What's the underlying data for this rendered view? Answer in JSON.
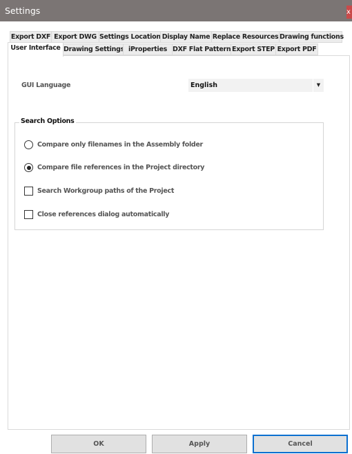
{
  "window": {
    "title": "Settings",
    "close_label": "x"
  },
  "tabs_row1": [
    {
      "label": "Export DXF"
    },
    {
      "label": "Export DWG"
    },
    {
      "label": "Settings Location"
    },
    {
      "label": "Display Name"
    },
    {
      "label": "Replace Resources"
    },
    {
      "label": "Drawing functions"
    }
  ],
  "tabs_row2": [
    {
      "label": "User Interface",
      "selected": true
    },
    {
      "label": "Drawing Settings"
    },
    {
      "label": "iProperties"
    },
    {
      "label": "DXF Flat Pattern"
    },
    {
      "label": "Export STEP"
    },
    {
      "label": "Export PDF"
    }
  ],
  "gui_language": {
    "label": "GUI Language",
    "value": "English"
  },
  "search_options": {
    "title": "Search Options",
    "options": [
      {
        "type": "radio",
        "label": "Compare only filenames in the Assembly folder",
        "checked": false
      },
      {
        "type": "radio",
        "label": "Compare file references in the Project directory",
        "checked": true
      },
      {
        "type": "checkbox",
        "label": "Search Workgroup paths of the Project",
        "checked": false
      },
      {
        "type": "checkbox",
        "label": "Close references dialog automatically",
        "checked": false
      }
    ]
  },
  "buttons": {
    "ok": "OK",
    "apply": "Apply",
    "cancel": "Cancel"
  },
  "colors": {
    "titlebar": "#7b7574",
    "default_button_border": "#0a6fd0"
  }
}
